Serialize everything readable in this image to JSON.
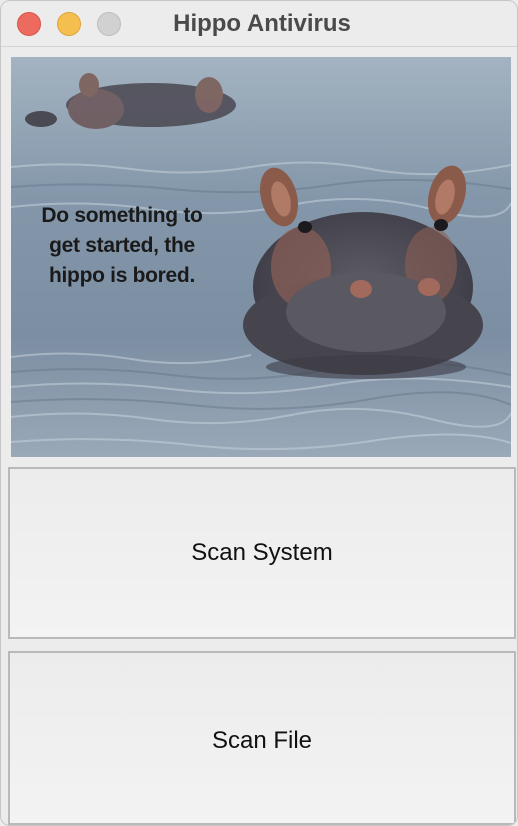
{
  "window": {
    "title": "Hippo Antivirus"
  },
  "image": {
    "caption": "Do something to get started, the hippo is bored."
  },
  "buttons": {
    "scan_system_label": "Scan System",
    "scan_file_label": "Scan File"
  },
  "colors": {
    "close": "#ed6a5e",
    "minimize": "#f5bf4f",
    "zoom_inactive": "#d1d1d1",
    "window_bg": "#ececec"
  }
}
